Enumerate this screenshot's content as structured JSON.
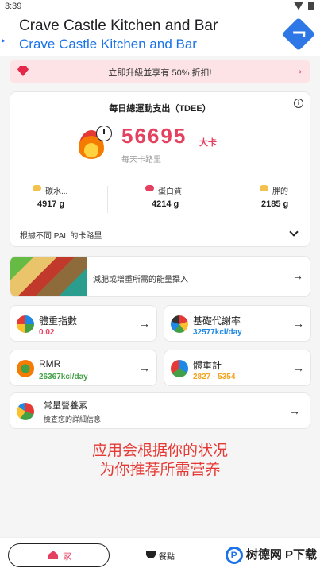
{
  "status_bar": {
    "time": "3:39"
  },
  "ad": {
    "line1": "Crave Castle Kitchen and Bar",
    "line2": "Crave Castle Kitchen and Bar"
  },
  "promo": {
    "text": "立即升級並享有 50% 折扣!"
  },
  "tdee": {
    "title": "每日總運動支出（TDEE）",
    "calories": "56695",
    "unit": "大卡",
    "subtitle": "每天卡路里",
    "macros": [
      {
        "name": "碳水...",
        "value": "4917 g",
        "color": "#f2c14e"
      },
      {
        "name": "蛋白質",
        "value": "4214 g",
        "color": "#e4405f"
      },
      {
        "name": "胖的",
        "value": "2185 g",
        "color": "#f2c14e"
      }
    ],
    "pal_label": "根據不同 PAL 的卡路里"
  },
  "food_card": {
    "text": "減肥或增重所需的能量攝入"
  },
  "metrics": {
    "bmi": {
      "title": "體重指數",
      "value": "0.02",
      "color": "#e4405f"
    },
    "bmr": {
      "title": "基礎代謝率",
      "value": "32577kcl/day",
      "color": "#1e88e5"
    },
    "rmr": {
      "title": "RMR",
      "value": "26367kcl/day",
      "color": "#43a047"
    },
    "weight": {
      "title": "體重計",
      "value": "2827 - 5354",
      "color": "#f2a21e"
    }
  },
  "macro_card": {
    "title": "常量營養素",
    "subtitle": "檢查您的詳細信息"
  },
  "overlay": {
    "line1": "应用会根据你的状况",
    "line2": "为你推荐所需营养"
  },
  "nav": {
    "home": "家",
    "meal": "餐點"
  },
  "watermark": "树德网 P下载"
}
